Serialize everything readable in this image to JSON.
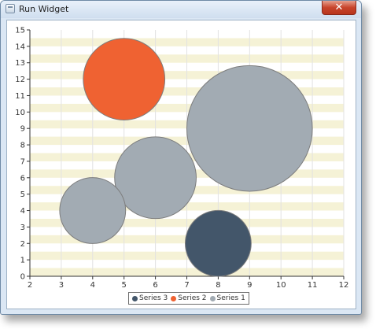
{
  "window": {
    "title": "Run Widget",
    "close_glyph": "✕",
    "icons": {
      "app": "app-window-icon",
      "close": "close-icon"
    }
  },
  "chart_data": {
    "type": "bubble",
    "xlim": [
      2,
      12
    ],
    "ylim": [
      0,
      15
    ],
    "x_ticks": [
      2,
      3,
      4,
      5,
      6,
      7,
      8,
      9,
      10,
      11,
      12
    ],
    "y_ticks": [
      0,
      1,
      2,
      3,
      4,
      5,
      6,
      7,
      8,
      9,
      10,
      11,
      12,
      13,
      14,
      15
    ],
    "grid": true,
    "legend_position": "bottom",
    "series": [
      {
        "name": "Series 1",
        "color": "#a2abb3",
        "points": [
          {
            "x": 9,
            "y": 9,
            "r": 2
          },
          {
            "x": 6,
            "y": 6,
            "r": 1.3
          },
          {
            "x": 4,
            "y": 4,
            "r": 1.05
          }
        ]
      },
      {
        "name": "Series 2",
        "color": "#ef6232",
        "points": [
          {
            "x": 5,
            "y": 12,
            "r": 1.3
          }
        ]
      },
      {
        "name": "Series 3",
        "color": "#43566a",
        "points": [
          {
            "x": 8,
            "y": 2,
            "r": 1.05
          }
        ]
      }
    ],
    "legend_order": [
      "Series 3",
      "Series 2",
      "Series 1"
    ]
  }
}
